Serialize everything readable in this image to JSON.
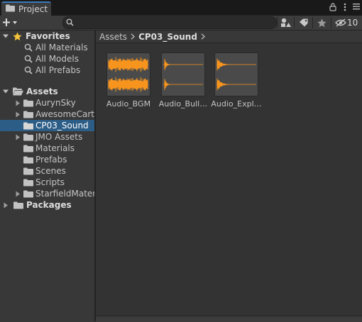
{
  "window": {
    "tab_label": "Project",
    "tab_icon": "folder-icon",
    "controls": [
      "more-vertical-icon",
      "lock-icon",
      "menu-icon"
    ]
  },
  "toolbar": {
    "create_label": "+▾",
    "search": {
      "value": "",
      "placeholder": ""
    },
    "hidden_count": "10",
    "icons": [
      "search-by-type-icon",
      "search-by-label-icon",
      "favorite-star-icon",
      "hidden-packages-icon"
    ]
  },
  "tree": {
    "favorites": {
      "label": "Favorites",
      "items": [
        {
          "label": "All Materials"
        },
        {
          "label": "All Models"
        },
        {
          "label": "All Prefabs"
        }
      ]
    },
    "assets": {
      "label": "Assets",
      "items": [
        {
          "label": "AurynSky",
          "has_children": true
        },
        {
          "label": "AwesomeCartoonS",
          "has_children": true
        },
        {
          "label": "CP03_Sound",
          "has_children": false,
          "selected": true
        },
        {
          "label": "JMO Assets",
          "has_children": true
        },
        {
          "label": "Materials",
          "has_children": false
        },
        {
          "label": "Prefabs",
          "has_children": false
        },
        {
          "label": "Scenes",
          "has_children": false
        },
        {
          "label": "Scripts",
          "has_children": false
        },
        {
          "label": "StarfieldMaterial",
          "has_children": true
        }
      ]
    },
    "packages": {
      "label": "Packages"
    }
  },
  "breadcrumb": {
    "items": [
      {
        "label": "Assets"
      },
      {
        "label": "CP03_Sound"
      }
    ]
  },
  "assets_grid": {
    "items": [
      {
        "name": "Audio_BGM",
        "kind": "audio-clip"
      },
      {
        "name": "Audio_Bull…",
        "kind": "audio-clip"
      },
      {
        "name": "Audio_Expl…",
        "kind": "audio-clip"
      }
    ],
    "waveform_color": "#f7941d"
  },
  "colors": {
    "selection": "#2c5d87",
    "folder": "#c2c2c2",
    "star": "#f4c23b",
    "waveform": "#f7941d"
  }
}
